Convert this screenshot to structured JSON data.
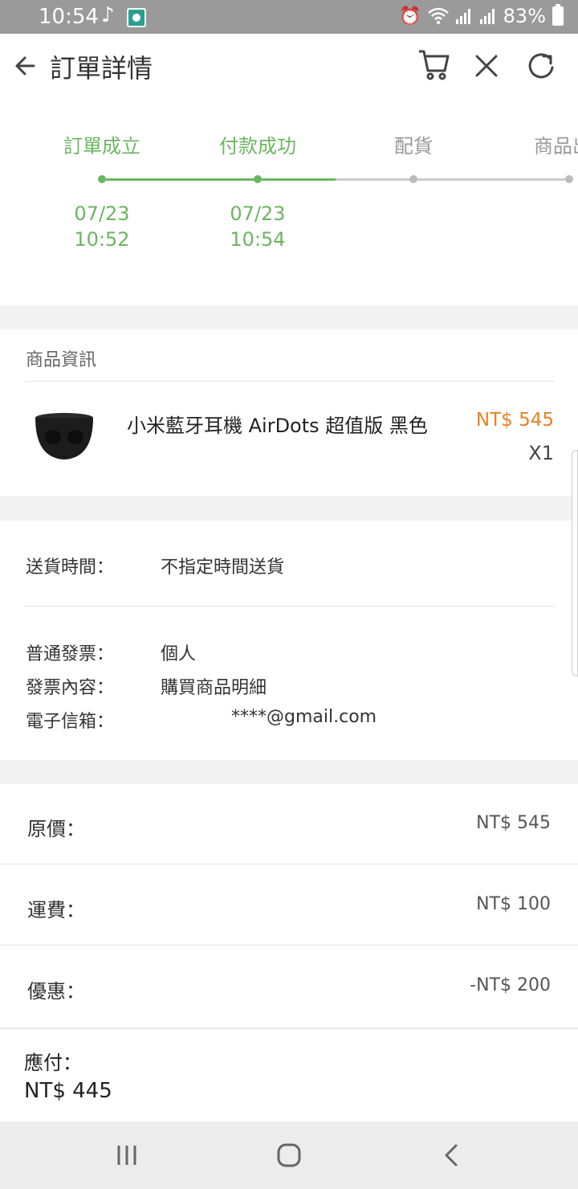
{
  "status_bar": {
    "time": "10:54",
    "battery": "83%"
  },
  "header": {
    "title": "訂單詳情"
  },
  "progress": {
    "steps": [
      {
        "label": "訂單成立",
        "date": "07/23",
        "time": "10:52",
        "done": true
      },
      {
        "label": "付款成功",
        "date": "07/23",
        "time": "10:54",
        "done": true
      },
      {
        "label": "配貨",
        "done": false
      },
      {
        "label": "商品出",
        "done": false
      }
    ],
    "colors": {
      "done": "#6bb660",
      "todo": "#cccccc"
    }
  },
  "product": {
    "section_label": "商品資訊",
    "name": "小米藍牙耳機 AirDots 超值版 黑色",
    "price": "NT$ 545",
    "qty": "X1"
  },
  "info": {
    "delivery_label": "送貨時間：",
    "delivery_value": "不指定時間送貨",
    "invoice_label": "普通發票：",
    "invoice_value": "個人",
    "invoice_content_label": "發票內容：",
    "invoice_content_value": "購買商品明細",
    "email_label": "電子信箱：",
    "email_value": "****@gmail.com"
  },
  "prices": {
    "original_label": "原價：",
    "original_value": "NT$ 545",
    "shipping_label": "運費：",
    "shipping_value": "NT$ 100",
    "discount_label": "優惠：",
    "discount_value": "-NT$ 200"
  },
  "total": {
    "label": "應付：",
    "value": "NT$ 445"
  },
  "accent_colors": {
    "green": "#6bb660",
    "orange": "#e58125"
  }
}
